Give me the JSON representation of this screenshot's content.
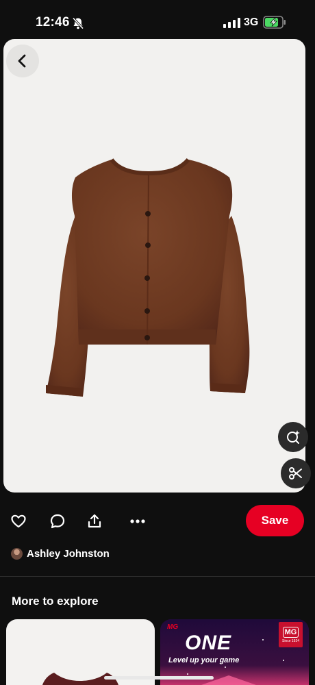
{
  "status_bar": {
    "time": "12:46",
    "network": "3G",
    "signal_bars": 4,
    "battery_charging": true,
    "silent_mode": true
  },
  "pin": {
    "image": "brown knit cardigan",
    "back_icon": "chevron-left-icon"
  },
  "floating_actions": {
    "lens_icon": "visual-search-icon",
    "cutout_icon": "scissors-icon"
  },
  "actions": {
    "like_icon": "heart-icon",
    "comment_icon": "comment-icon",
    "share_icon": "share-icon",
    "more_icon": "more-icon",
    "save_label": "Save"
  },
  "author": {
    "name": "Ashley Johnston"
  },
  "explore": {
    "title": "More to explore",
    "ad": {
      "brand": "MG",
      "headline": "ONE",
      "tagline": "Level up your game",
      "badge": "MG",
      "badge_since": "Since 1924"
    }
  },
  "colors": {
    "background": "#0f0f0f",
    "save_button": "#e60023",
    "card_background": "#f2f1ef",
    "sweater": "#6e3b22"
  }
}
